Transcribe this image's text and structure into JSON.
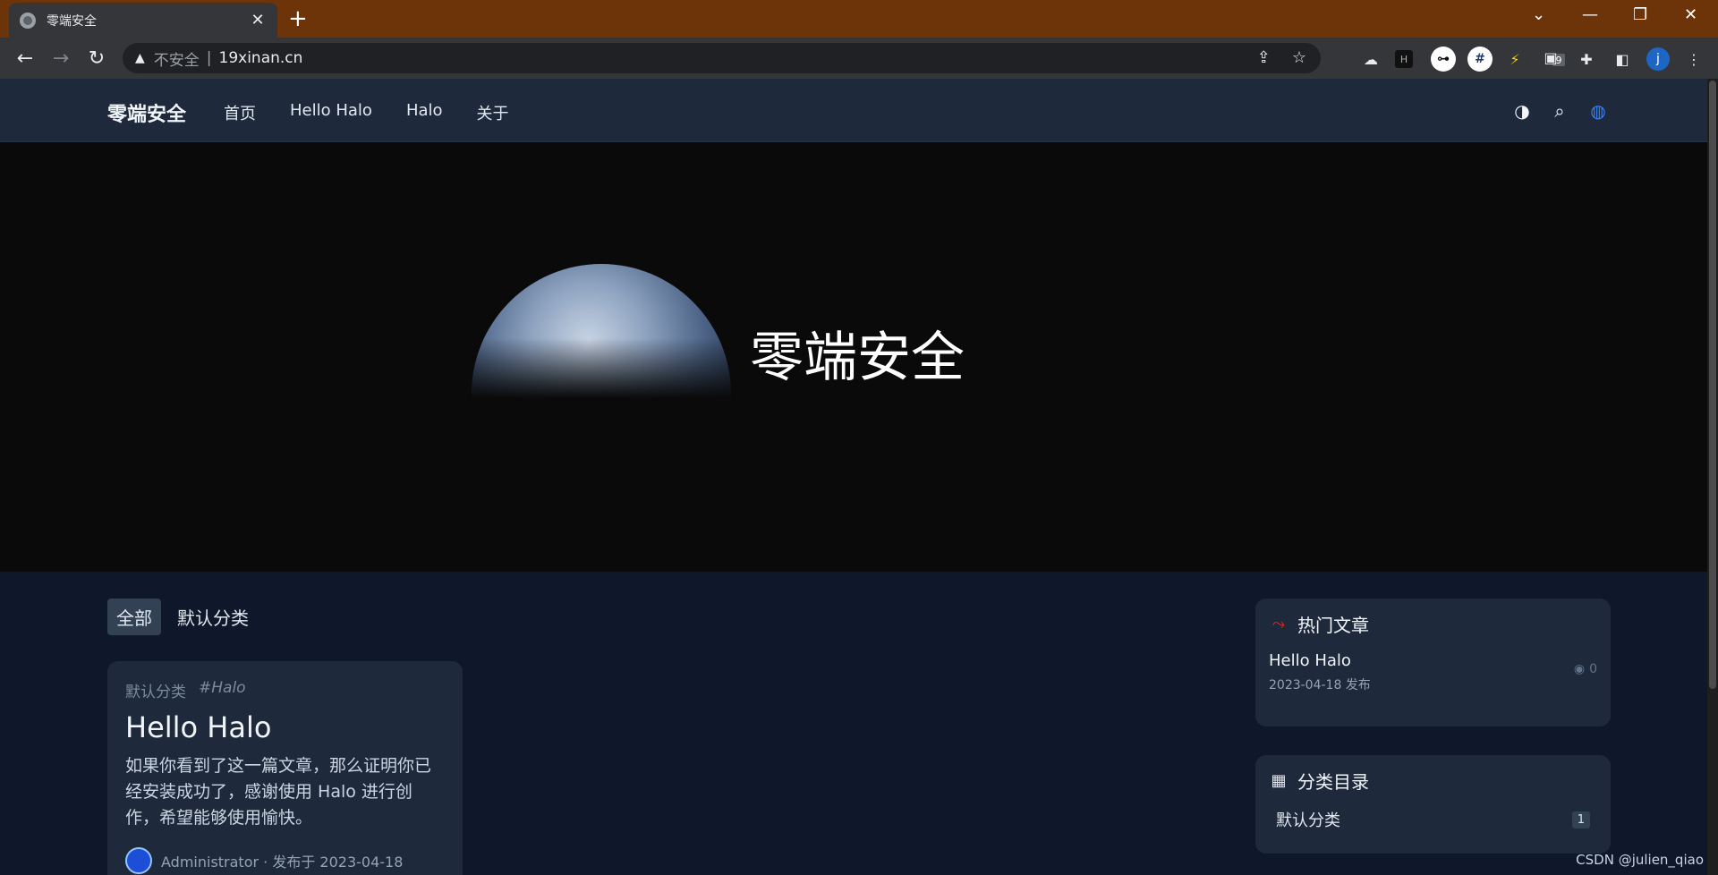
{
  "browser": {
    "tab_title": "零端安全",
    "tab_close": "✕",
    "new_tab": "+",
    "insecure_label": "不安全",
    "separator": "|",
    "url": "19xinan.cn",
    "controls": {
      "tab_search": "⌄",
      "minimize": "—",
      "restore": "❐",
      "close": "✕"
    },
    "nav": {
      "back": "←",
      "forward": "→",
      "reload": "↻"
    },
    "extensions": {
      "hash": "#",
      "bolt": "⚡",
      "badge": "9",
      "profile": "j"
    }
  },
  "site": {
    "brand": "零端安全",
    "nav": [
      "首页",
      "Hello Halo",
      "Halo",
      "关于"
    ],
    "hero_title": "零端安全"
  },
  "filters": [
    "全部",
    "默认分类"
  ],
  "post": {
    "category": "默认分类",
    "tag": "#Halo",
    "title": "Hello Halo",
    "excerpt": "如果你看到了这一篇文章，那么证明你已经安装成功了，感谢使用 Halo 进行创作，希望能够使用愉快。",
    "footer": "Administrator · 发布于 2023-04-18"
  },
  "hot_widget": {
    "title": "热门文章",
    "items": [
      {
        "title": "Hello Halo",
        "date": "2023-04-18 发布",
        "views": "0"
      }
    ]
  },
  "category_widget": {
    "title": "分类目录",
    "items": [
      {
        "name": "默认分类",
        "count": "1"
      }
    ]
  },
  "watermark": "CSDN @julien_qiao",
  "colors": {
    "tabbar": "#6e3409",
    "header": "#1e293b",
    "page": "#0f172a",
    "hot_icon": "#dc2626"
  }
}
